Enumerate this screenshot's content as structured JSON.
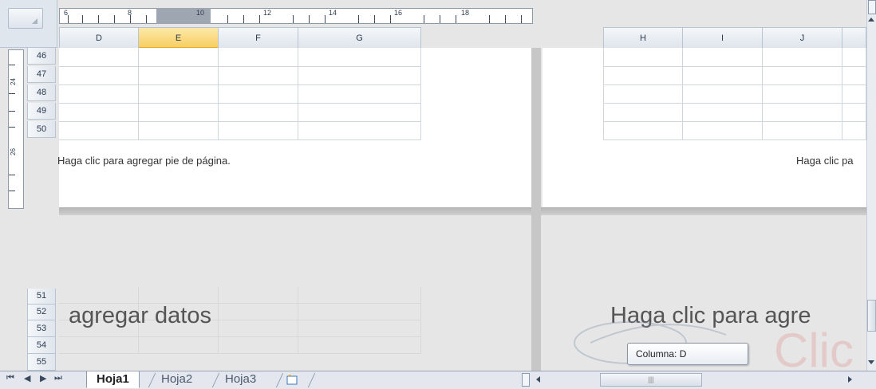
{
  "columns_left": [
    "D",
    "E",
    "F",
    "G"
  ],
  "columns_right": [
    "H",
    "I",
    "J"
  ],
  "selected_column": "E",
  "rows_top": [
    "46",
    "47",
    "48",
    "49",
    "50"
  ],
  "rows_bottom": [
    "51",
    "52",
    "53",
    "54",
    "55"
  ],
  "ruler": {
    "marks": [
      "6",
      "8",
      "10",
      "12",
      "14",
      "16",
      "18"
    ],
    "vertical_marks": [
      "24",
      "26"
    ]
  },
  "footer_left": "Haga clic para agregar pie de página.",
  "footer_right": "Haga clic pa",
  "big_left": "agregar datos",
  "big_right": "Haga clic para agre",
  "tooltip": "Columna: D",
  "sheets": {
    "tab1": "Hoja1",
    "tab2": "Hoja2",
    "tab3": "Hoja3"
  },
  "colors": {
    "selected_header": "#f7cf63",
    "page_bg": "#ffffff",
    "workspace_bg": "#e6e6e6"
  }
}
